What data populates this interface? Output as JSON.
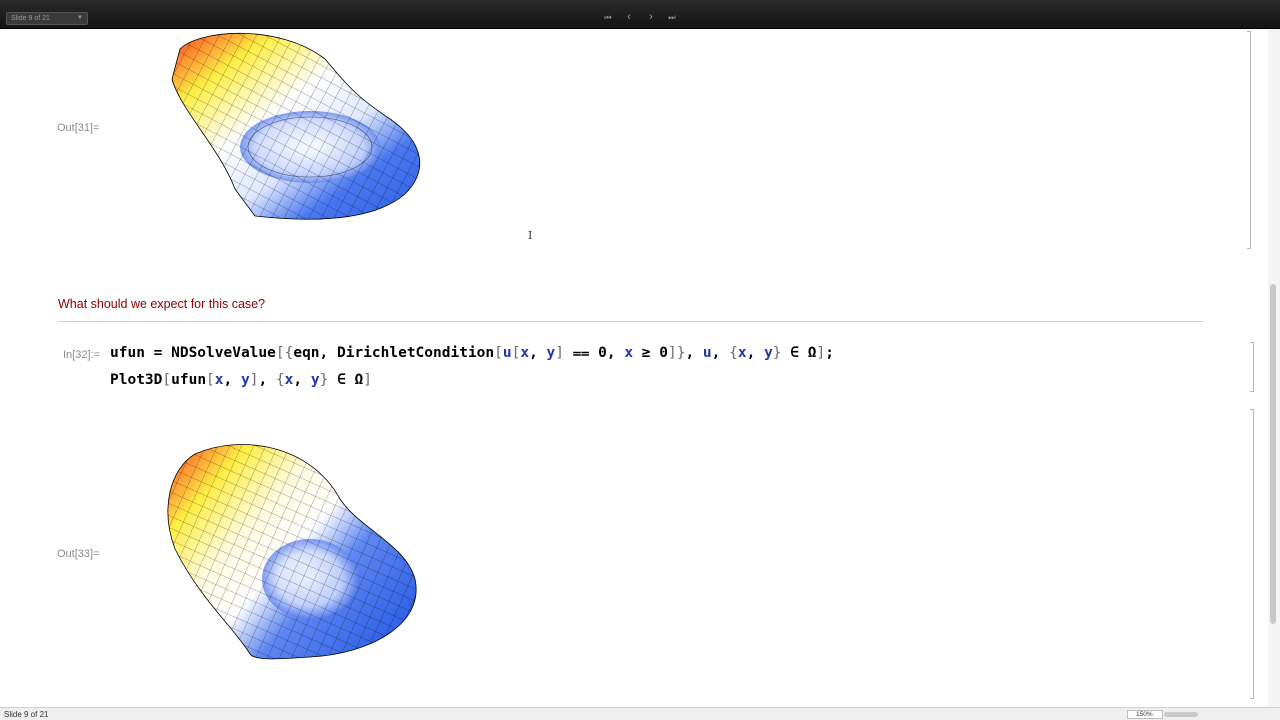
{
  "toolbar": {
    "slide_selector": "Slide 9 of 21",
    "nav": {
      "first": "⏮",
      "prev": "‹",
      "next": "›",
      "last": "⏭"
    }
  },
  "cells": {
    "out31_label": "Out[31]=",
    "question": "What should we expect for this case?",
    "in32_label": "In[32]:=",
    "in32_line1": [
      {
        "t": "ufun = NDSolveValue",
        "c": "k"
      },
      {
        "t": "[{",
        "c": "g"
      },
      {
        "t": "eqn, DirichletCondition",
        "c": "k"
      },
      {
        "t": "[",
        "c": "g"
      },
      {
        "t": "u",
        "c": "v"
      },
      {
        "t": "[",
        "c": "g"
      },
      {
        "t": "x",
        "c": "v"
      },
      {
        "t": ", ",
        "c": "k"
      },
      {
        "t": "y",
        "c": "v"
      },
      {
        "t": "] ",
        "c": "g"
      },
      {
        "t": "⩵ 0, ",
        "c": "k"
      },
      {
        "t": "x",
        "c": "v"
      },
      {
        "t": " ≥ 0",
        "c": "k"
      },
      {
        "t": "]}",
        "c": "g"
      },
      {
        "t": ", ",
        "c": "k"
      },
      {
        "t": "u",
        "c": "v"
      },
      {
        "t": ", ",
        "c": "k"
      },
      {
        "t": "{",
        "c": "g"
      },
      {
        "t": "x",
        "c": "v"
      },
      {
        "t": ", ",
        "c": "k"
      },
      {
        "t": "y",
        "c": "v"
      },
      {
        "t": "} ",
        "c": "g"
      },
      {
        "t": "∈ Ω",
        "c": "k"
      },
      {
        "t": "]",
        "c": "g"
      },
      {
        "t": ";",
        "c": "k"
      }
    ],
    "in32_line2": [
      {
        "t": "Plot3D",
        "c": "k"
      },
      {
        "t": "[",
        "c": "g"
      },
      {
        "t": "ufun",
        "c": "k"
      },
      {
        "t": "[",
        "c": "g"
      },
      {
        "t": "x",
        "c": "v"
      },
      {
        "t": ", ",
        "c": "k"
      },
      {
        "t": "y",
        "c": "v"
      },
      {
        "t": "]",
        "c": "g"
      },
      {
        "t": ", ",
        "c": "k"
      },
      {
        "t": "{",
        "c": "g"
      },
      {
        "t": "x",
        "c": "v"
      },
      {
        "t": ", ",
        "c": "k"
      },
      {
        "t": "y",
        "c": "v"
      },
      {
        "t": "} ",
        "c": "g"
      },
      {
        "t": "∈ Ω",
        "c": "k"
      },
      {
        "t": "]",
        "c": "g"
      }
    ],
    "out33_label": "Out[33]="
  },
  "status": {
    "text": "Slide 9 of 21",
    "zoom": "150%"
  },
  "colors": {
    "question": "#8b0000",
    "symbol_blue": "#1f3aa8",
    "surface_hot": "#ff1a1a",
    "surface_mid": "#ffee44",
    "surface_cold": "#2b5de6"
  }
}
